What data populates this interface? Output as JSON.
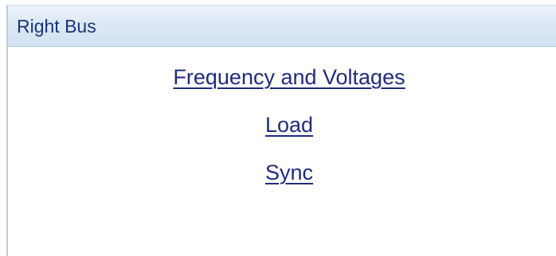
{
  "panel": {
    "title": "Right Bus",
    "links": [
      {
        "label": "Frequency and Voltages"
      },
      {
        "label": "Load"
      },
      {
        "label": "Sync"
      }
    ]
  }
}
